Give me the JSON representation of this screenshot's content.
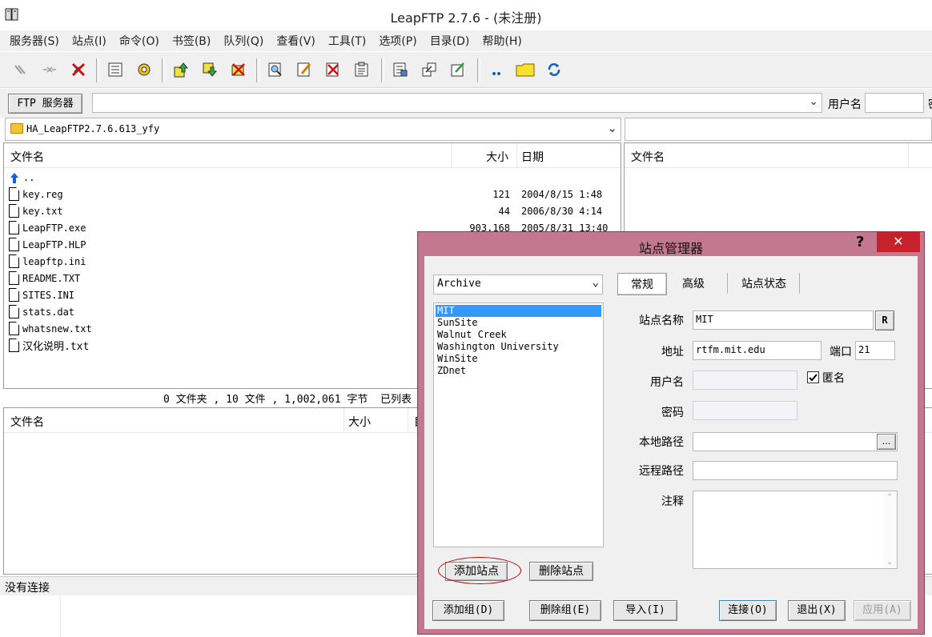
{
  "window": {
    "title": "LeapFTP 2.7.6 - (未注册)"
  },
  "menu": [
    "服务器(S)",
    "站点(I)",
    "命令(O)",
    "书签(B)",
    "队列(Q)",
    "查看(V)",
    "工具(T)",
    "选项(P)",
    "目录(D)",
    "帮助(H)"
  ],
  "toolbar_icons": [
    "connect-icon",
    "disconnect-icon",
    "abort-icon",
    "queue-list-icon",
    "settings-icon",
    "upload-icon",
    "download-icon",
    "delete-queue-icon",
    "find-icon",
    "edit-icon",
    "delete-icon",
    "properties-icon",
    "log-icon",
    "transfer-icon",
    "rename-icon",
    "dots-icon",
    "folder-icon",
    "refresh-icon"
  ],
  "serverbar": {
    "ftp_button": "FTP 服务器",
    "username_label": "用户名",
    "trailing_char": "密"
  },
  "local": {
    "path": "HA_LeapFTP2.7.6.613_yfy",
    "headers": {
      "name": "文件名",
      "size": "大小",
      "date": "日期"
    },
    "up_label": "..",
    "files": [
      {
        "name": "key.reg",
        "size": "121",
        "date": "2004/8/15 1:48"
      },
      {
        "name": "key.txt",
        "size": "44",
        "date": "2006/8/30 4:14"
      },
      {
        "name": "LeapFTP.exe",
        "size": "903,168",
        "date": "2005/8/31 13:40"
      },
      {
        "name": "LeapFTP.HLP",
        "size": "",
        "date": ""
      },
      {
        "name": "leapftp.ini",
        "size": "",
        "date": ""
      },
      {
        "name": "README.TXT",
        "size": "",
        "date": ""
      },
      {
        "name": "SITES.INI",
        "size": "",
        "date": ""
      },
      {
        "name": "stats.dat",
        "size": "",
        "date": ""
      },
      {
        "name": "whatsnew.txt",
        "size": "",
        "date": ""
      },
      {
        "name": "汉化说明.txt",
        "size": "",
        "date": ""
      }
    ],
    "status": "0 文件夹 , 10 文件 , 1,002,061 字节  已列表"
  },
  "remote": {
    "headers": {
      "name": "文件名"
    }
  },
  "queue": {
    "headers": {
      "name": "文件名",
      "size": "大小",
      "extra": "目"
    }
  },
  "statusbar": {
    "text": "没有连接"
  },
  "dialog": {
    "title": "站点管理器",
    "help": "?",
    "close": "✕",
    "group_select": "Archive",
    "sites": [
      "MIT",
      "SunSite",
      "Walnut Creek",
      "Washington University",
      "WinSite",
      "ZDnet"
    ],
    "selected_site": "MIT",
    "tabs": [
      "常规",
      "高级",
      "站点状态"
    ],
    "active_tab": "常规",
    "labels": {
      "site_name": "站点名称",
      "address": "地址",
      "port": "端口",
      "username": "用户名",
      "anonymous": "匿名",
      "password": "密码",
      "local_path": "本地路径",
      "remote_path": "远程路径",
      "comment": "注释"
    },
    "values": {
      "site_name": "MIT",
      "address": "rtfm.mit.edu",
      "port": "21",
      "username": "",
      "password": "",
      "local_path": "",
      "remote_path": "",
      "comment": "",
      "anonymous_checked": true
    },
    "r_button": "R",
    "browse_button": "...",
    "buttons": {
      "add_site": "添加站点",
      "delete_site": "删除站点",
      "add_group": "添加组(D)",
      "delete_group": "删除组(E)",
      "import": "导入(I)",
      "connect": "连接(O)",
      "exit": "退出(X)",
      "apply": "应用(A)"
    },
    "highlight_color": "#cc0000"
  }
}
